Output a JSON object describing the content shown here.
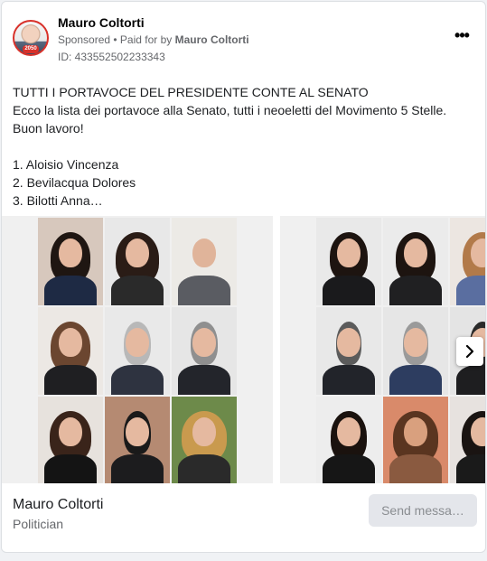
{
  "post": {
    "page_name": "Mauro Coltorti",
    "sponsored_label": "Sponsored",
    "paid_for_prefix": " • Paid for by ",
    "paid_for_name": "Mauro Coltorti",
    "ad_id": "ID: 433552502233343",
    "avatar_badge": "2050",
    "more_icon": "more-horizontal-icon",
    "more_label": "•••"
  },
  "body": {
    "lines": [
      "TUTTI I PORTAVOCE DEL PRESIDENTE CONTE AL SENATO",
      "Ecco la lista dei portavoce alla Senato, tutti i neoeletti del Movimento 5 Stelle.",
      "Buon lavoro!",
      "",
      "1. Aloisio Vincenza",
      "2. Bevilacqua Dolores",
      "3. Bilotti Anna…"
    ]
  },
  "carousel": {
    "next_icon": "chevron-right-icon",
    "colors": {
      "slide_bg": "#f0f0f0",
      "suit_dark": "#2b2f36",
      "suit_navy": "#2d3d60",
      "skin": "#e5b9a0",
      "hair_dark": "#3a2a22"
    }
  },
  "footer": {
    "title": "Mauro Coltorti",
    "subtitle": "Politician",
    "button_label": "Send messa…"
  }
}
